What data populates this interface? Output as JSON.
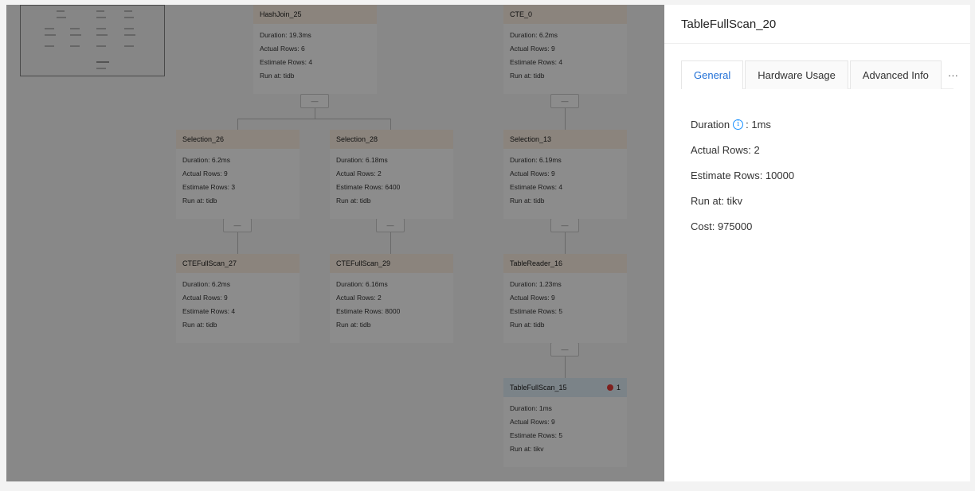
{
  "nodes": [
    {
      "title": "HashJoin_25",
      "duration": "Duration: 19.3ms",
      "actual": "Actual Rows: 6",
      "estimate": "Estimate Rows: 4",
      "run": "Run at: tidb"
    },
    {
      "title": "CTE_0",
      "duration": "Duration: 6.2ms",
      "actual": "Actual Rows: 9",
      "estimate": "Estimate Rows: 4",
      "run": "Run at: tidb"
    },
    {
      "title": "Selection_26",
      "duration": "Duration: 6.2ms",
      "actual": "Actual Rows: 9",
      "estimate": "Estimate Rows: 3",
      "run": "Run at: tidb"
    },
    {
      "title": "Selection_28",
      "duration": "Duration: 6.18ms",
      "actual": "Actual Rows: 2",
      "estimate": "Estimate Rows: 6400",
      "run": "Run at: tidb"
    },
    {
      "title": "Selection_13",
      "duration": "Duration: 6.19ms",
      "actual": "Actual Rows: 9",
      "estimate": "Estimate Rows: 4",
      "run": "Run at: tidb"
    },
    {
      "title": "CTEFullScan_27",
      "duration": "Duration: 6.2ms",
      "actual": "Actual Rows: 9",
      "estimate": "Estimate Rows: 4",
      "run": "Run at: tidb"
    },
    {
      "title": "CTEFullScan_29",
      "duration": "Duration: 6.16ms",
      "actual": "Actual Rows: 2",
      "estimate": "Estimate Rows: 8000",
      "run": "Run at: tidb"
    },
    {
      "title": "TableReader_16",
      "duration": "Duration: 1.23ms",
      "actual": "Actual Rows: 9",
      "estimate": "Estimate Rows: 5",
      "run": "Run at: tidb"
    },
    {
      "title": "TableFullScan_15",
      "duration": "Duration: 1ms",
      "actual": "Actual Rows: 9",
      "estimate": "Estimate Rows: 5",
      "run": "Run at: tikv",
      "badge": "1"
    }
  ],
  "collapse_symbol": "—",
  "panel": {
    "title": "TableFullScan_20",
    "tabs": [
      "General",
      "Hardware Usage",
      "Advanced Info"
    ],
    "more": "···",
    "duration_label": "Duration",
    "duration_value": ": 1ms",
    "actual_rows": "Actual Rows: 2",
    "estimate_rows": "Estimate Rows: 10000",
    "run_at": "Run at: tikv",
    "cost": "Cost: 975000"
  },
  "colors": {
    "accent": "#1f6fd6",
    "info": "#1890ff",
    "error": "#e53935",
    "node_header": "#fdf1e3",
    "selected_header": "#e0eef7"
  },
  "icons": {
    "info": "info-icon",
    "error": "error-dot-icon"
  }
}
